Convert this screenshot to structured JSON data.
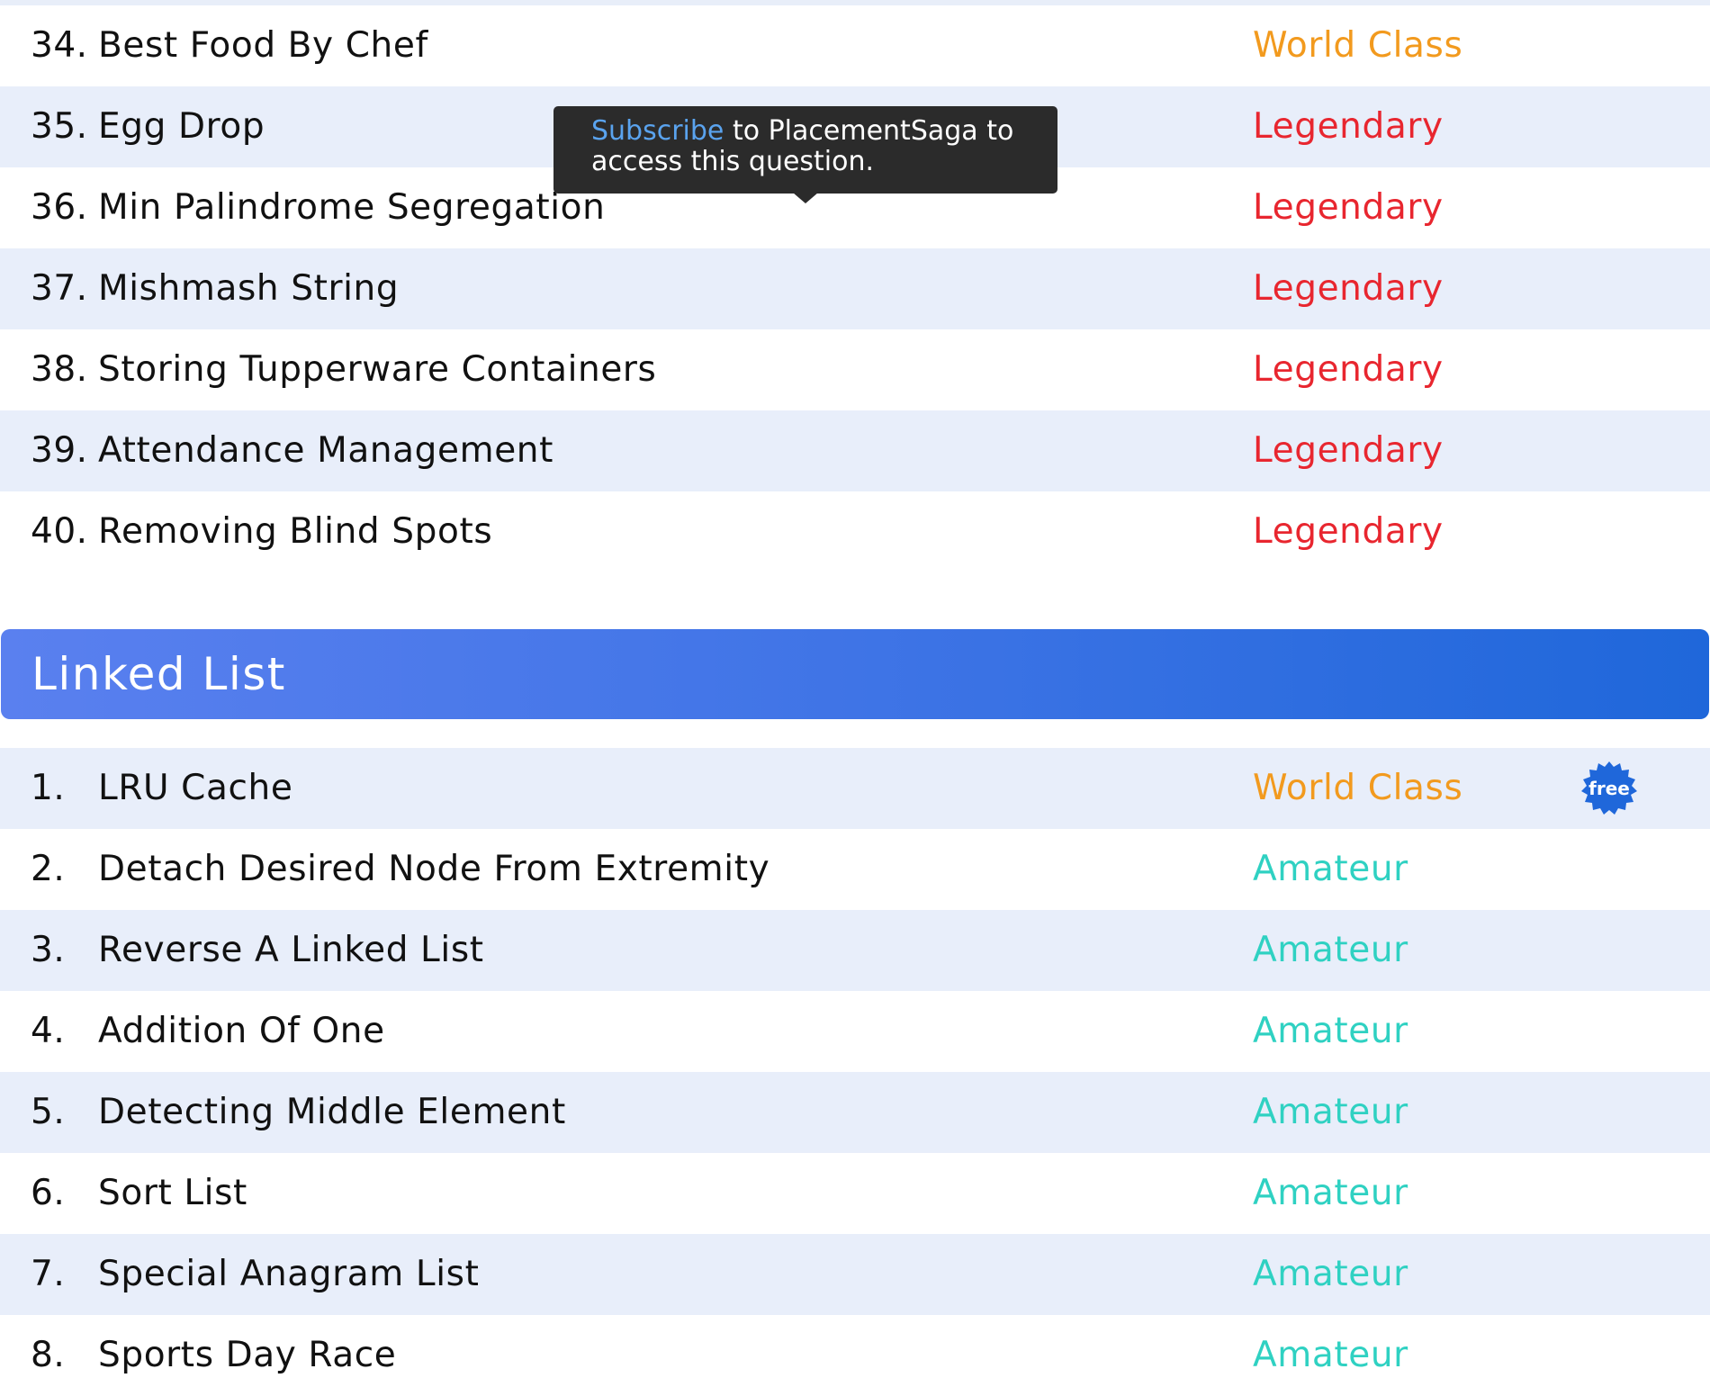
{
  "colors": {
    "world_class": "#f29a1e",
    "legendary": "#e8262f",
    "amateur": "#2fd1c2",
    "row_shade": "#e8eefa",
    "header_start": "#5a80ef",
    "header_end": "#1f67da",
    "badge": "#1f67da",
    "tooltip_bg": "#2b2b2b",
    "tooltip_link": "#5aa3ee"
  },
  "previous_section": {
    "rows": [
      {
        "num": "34.",
        "name": "Best Food By Chef",
        "level": "World Class"
      },
      {
        "num": "35.",
        "name": "Egg Drop",
        "level": "Legendary"
      },
      {
        "num": "36.",
        "name": "Min Palindrome Segregation",
        "level": "Legendary"
      },
      {
        "num": "37.",
        "name": "Mishmash String",
        "level": "Legendary"
      },
      {
        "num": "38.",
        "name": "Storing Tupperware Containers",
        "level": "Legendary"
      },
      {
        "num": "39.",
        "name": "Attendance Management",
        "level": "Legendary"
      },
      {
        "num": "40.",
        "name": "Removing Blind Spots",
        "level": "Legendary"
      }
    ]
  },
  "tooltip": {
    "link_text": "Subscribe",
    "line1_rest": " to PlacementSaga to",
    "line2": "access this question."
  },
  "linked_list": {
    "title": "Linked List",
    "rows": [
      {
        "num": "1.",
        "name": "LRU Cache",
        "level": "World Class",
        "badge": "free"
      },
      {
        "num": "2.",
        "name": "Detach Desired Node From Extremity",
        "level": "Amateur"
      },
      {
        "num": "3.",
        "name": "Reverse A Linked List",
        "level": "Amateur"
      },
      {
        "num": "4.",
        "name": "Addition Of One",
        "level": "Amateur"
      },
      {
        "num": "5.",
        "name": "Detecting Middle Element",
        "level": "Amateur"
      },
      {
        "num": "6.",
        "name": "Sort List",
        "level": "Amateur"
      },
      {
        "num": "7.",
        "name": "Special Anagram List",
        "level": "Amateur"
      },
      {
        "num": "8.",
        "name": "Sports Day Race",
        "level": "Amateur"
      }
    ]
  }
}
